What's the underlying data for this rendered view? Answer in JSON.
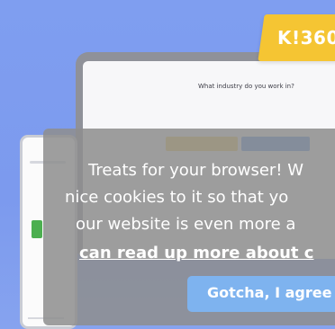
{
  "brand": {
    "logo_text": "K!360"
  },
  "laptop": {
    "question": "What industry do you work in?"
  },
  "cookie_banner": {
    "line1": "Treats for your browser! W",
    "line2": "nice cookies to it so that yo",
    "line3": "our website is even more a",
    "link_text": "can read up more about c",
    "agree_label": "Gotcha, I agree"
  },
  "colors": {
    "background": "#7f9ef0",
    "brand": "#f5c533",
    "banner": "#8e8e8e",
    "agree_button": "#7eb3ef"
  }
}
